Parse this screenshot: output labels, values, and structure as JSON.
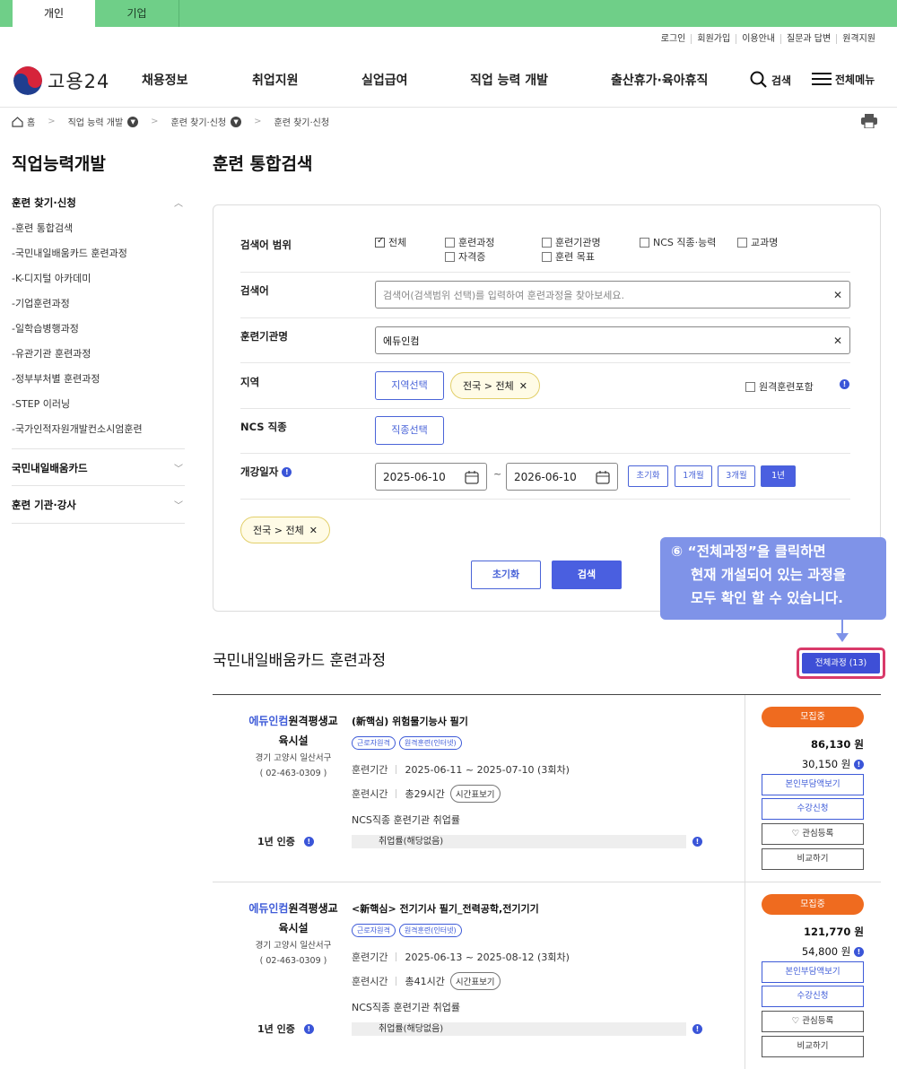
{
  "audience_tabs": [
    "개인",
    "기업"
  ],
  "util_links": [
    "로그인",
    "회원가입",
    "이용안내",
    "질문과 답변",
    "원격지원"
  ],
  "logo_text": "고용24",
  "gnb": [
    "채용정보",
    "취업지원",
    "실업급여",
    "직업 능력 개발",
    "출산휴가·육아휴직"
  ],
  "header_right": {
    "search": "검색",
    "menu": "전체메뉴"
  },
  "breadcrumb": [
    "홈",
    "직업 능력 개발",
    "훈련 찾기·신청",
    "훈련 찾기·신청"
  ],
  "sidebar": {
    "title": "직업능력개발",
    "section1": "훈련 찾기·신청",
    "items": [
      "-훈련 통합검색",
      "-국민내일배움카드 훈련과정",
      "-K-디지털 아카데미",
      "-기업훈련과정",
      "-일학습병행과정",
      "-유관기관 훈련과정",
      "-정부부처별 훈련과정",
      "-STEP 이러닝",
      "-국가인적자원개발컨소시엄훈련"
    ],
    "section2": "국민내일배움카드",
    "section3": "훈련 기관·강사"
  },
  "main_title": "훈련 통합검색",
  "form": {
    "scope_label": "검색어 범위",
    "scope_options": [
      "전체",
      "훈련과정",
      "훈련기관명",
      "NCS 직종·능력",
      "교과명",
      "자격증",
      "훈련 목표"
    ],
    "keyword_label": "검색어",
    "keyword_placeholder": "검색어(검색범위 선택)를 입력하여 훈련과정을 찾아보세요.",
    "inst_label": "훈련기관명",
    "inst_value": "에듀인컴",
    "region_label": "지역",
    "region_btn": "지역선택",
    "region_chip": "전국 > 전체",
    "remote_label": "원격훈련포함",
    "ncs_label": "NCS 직종",
    "ncs_btn": "직종선택",
    "date_label": "개강일자",
    "date_from": "2025-06-10",
    "date_to": "2026-06-10",
    "date_sep": "~",
    "period_btns": [
      "초기화",
      "1개월",
      "3개월",
      "1년"
    ],
    "summary_chip": "전국 > 전체",
    "reset": "초기화",
    "search": "검색"
  },
  "callout": [
    "⑥ “전체과정”을 클릭하면",
    "현재 개설되어 있는 과정을",
    "모두 확인 할 수 있습니다."
  ],
  "section_title": "국민내일배움카드 훈련과정",
  "all_courses_btn": "전체과정 (13)",
  "courses": [
    {
      "org_hl": "에듀인컴",
      "org_rest": "원격평생교",
      "org_line2": "육시설",
      "addr": "경기 고양시 일산서구",
      "phone": "( 02-463-0309 )",
      "cert": "1년 인증",
      "name": "(新핵심) 위험물기능사 필기",
      "tags": [
        "근로자원격",
        "원격훈련(인터넷)"
      ],
      "period_label": "훈련기간",
      "period": "2025-06-11 ~ 2025-07-10 (3회차)",
      "hours_label": "훈련시간",
      "hours": "총29시간",
      "timetable": "시간표보기",
      "emp_title": "NCS직종 훈련기관 취업률",
      "emp_value": "취업률(해당없음)",
      "status": "모집중",
      "price": "86,130 원",
      "self_pay": "30,150 원",
      "btns": [
        "본인부담액보기",
        "수강신청",
        "♡ 관심등록",
        "비교하기"
      ]
    },
    {
      "org_hl": "에듀인컴",
      "org_rest": "원격평생교",
      "org_line2": "육시설",
      "addr": "경기 고양시 일산서구",
      "phone": "( 02-463-0309 )",
      "cert": "1년 인증",
      "name": "<新핵심> 전기기사 필기_전력공학,전기기기",
      "tags": [
        "근로자원격",
        "원격훈련(인터넷)"
      ],
      "period_label": "훈련기간",
      "period": "2025-06-13 ~ 2025-08-12 (3회차)",
      "hours_label": "훈련시간",
      "hours": "총41시간",
      "timetable": "시간표보기",
      "emp_title": "NCS직종 훈련기관 취업률",
      "emp_value": "취업률(해당없음)",
      "status": "모집중",
      "price": "121,770 원",
      "self_pay": "54,800 원",
      "btns": [
        "본인부담액보기",
        "수강신청",
        "♡ 관심등록",
        "비교하기"
      ]
    }
  ],
  "colors": {
    "accent": "#4a5fe0",
    "green_bar": "#6fcf88",
    "status_orange": "#ef6b1f",
    "highlight_border": "#d93a6a",
    "callout_bg": "#7f93e8"
  }
}
